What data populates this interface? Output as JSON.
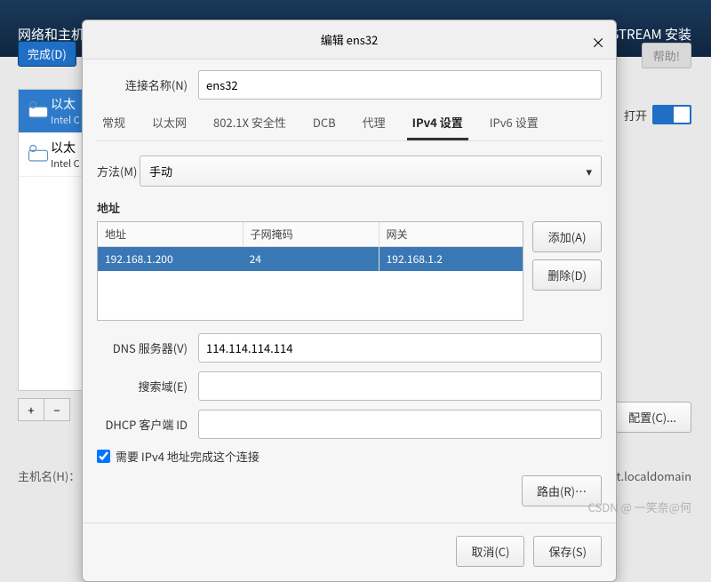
{
  "bg": {
    "title": "网络和主机",
    "install": "STREAM 安装",
    "done": "完成(D)",
    "help": "帮助!",
    "items": [
      {
        "name": "以太",
        "sub": "Intel C"
      },
      {
        "name": "以太",
        "sub": "Intel C"
      }
    ],
    "toggle": "打开",
    "config": "配置(C)...",
    "host_label": "主机名(H)：",
    "host_value": "ost.localdomain"
  },
  "modal": {
    "title": "编辑 ens32",
    "close": "×",
    "conn_label": "连接名称(N)",
    "conn_value": "ens32",
    "tabs": [
      "常规",
      "以太网",
      "802.1X 安全性",
      "DCB",
      "代理",
      "IPv4 设置",
      "IPv6 设置"
    ],
    "active_tab": 5,
    "method_label": "方法(M)",
    "method_value": "手动",
    "addr_section": "地址",
    "headers": [
      "地址",
      "子网掩码",
      "网关"
    ],
    "row": {
      "addr": "192.168.1.200",
      "mask": "24",
      "gw": "192.168.1.2"
    },
    "add": "添加(A)",
    "del": "删除(D)",
    "dns_label": "DNS 服务器(V)",
    "dns_value": "114.114.114.114",
    "search_label": "搜索域(E)",
    "search_value": "",
    "dhcp_label": "DHCP 客户端 ID",
    "dhcp_value": "",
    "require": "需要 IPv4 地址完成这个连接",
    "route": "路由(R)…",
    "cancel": "取消(C)",
    "save": "保存(S)"
  },
  "watermark": "CSDN @ 一笑奈@何"
}
